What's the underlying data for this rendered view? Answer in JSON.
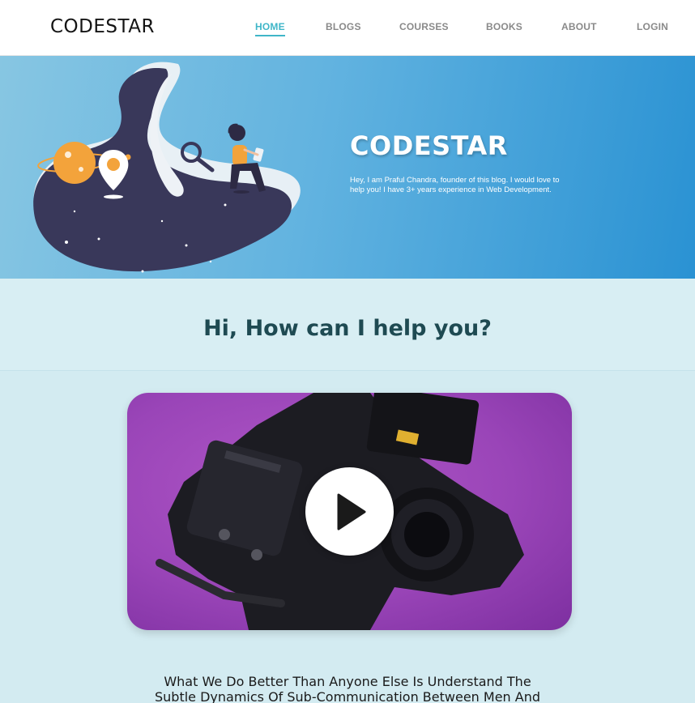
{
  "brand": {
    "logo": "CODESTAR"
  },
  "nav": {
    "items": [
      {
        "label": "HOME"
      },
      {
        "label": "BLOGS"
      },
      {
        "label": "COURSES"
      },
      {
        "label": "BOOKS"
      },
      {
        "label": "ABOUT"
      },
      {
        "label": "LOGIN"
      }
    ],
    "active": "HOME",
    "accent_color": "#3fb6c8"
  },
  "hero": {
    "title": "CODESTAR",
    "description": "Hey, I am Praful Chandra, founder of this blog. I would love to help you! I have 3+ years experience in Web Development."
  },
  "help": {
    "heading": "Hi, How can I help you?"
  },
  "video": {
    "play_icon": "play-icon"
  },
  "tagline": {
    "line1": "What We Do Better Than Anyone Else Is Understand The",
    "line2": "Subtle Dynamics Of Sub-Communication Between Men And"
  }
}
